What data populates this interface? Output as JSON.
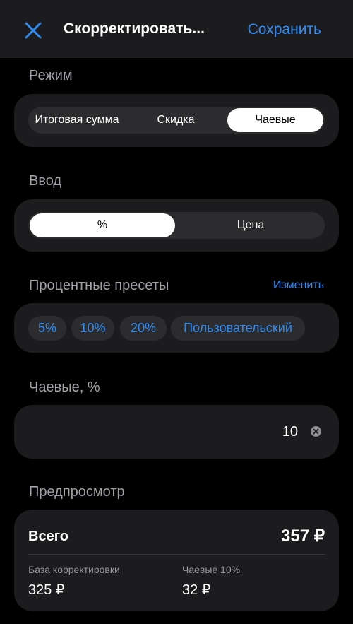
{
  "nav": {
    "close_icon": "close-icon",
    "title": "Скорректировать...",
    "save_label": "Сохранить"
  },
  "colors": {
    "accent": "#2f8cf3",
    "background": "#000000",
    "card": "#1c1c1e",
    "segment": "#2c2c2e"
  },
  "mode": {
    "label": "Режим",
    "options": [
      "Итоговая сумма",
      "Скидка",
      "Чаевые"
    ],
    "selected": "Чаевые"
  },
  "input": {
    "label": "Ввод",
    "options": [
      "%",
      "Цена"
    ],
    "selected": "%"
  },
  "presets": {
    "label": "Процентные пресеты",
    "edit_label": "Изменить",
    "items": [
      "5%",
      "10%",
      "20%",
      "Пользовательский"
    ]
  },
  "tip": {
    "label": "Чаевые, %",
    "value": "10"
  },
  "preview": {
    "label": "Предпросмотр",
    "total_label": "Всего",
    "total_value": "357 ₽",
    "base_label": "База корректировки",
    "base_value": "325 ₽",
    "tip_label": "Чаевые 10%",
    "tip_value": "32 ₽"
  }
}
